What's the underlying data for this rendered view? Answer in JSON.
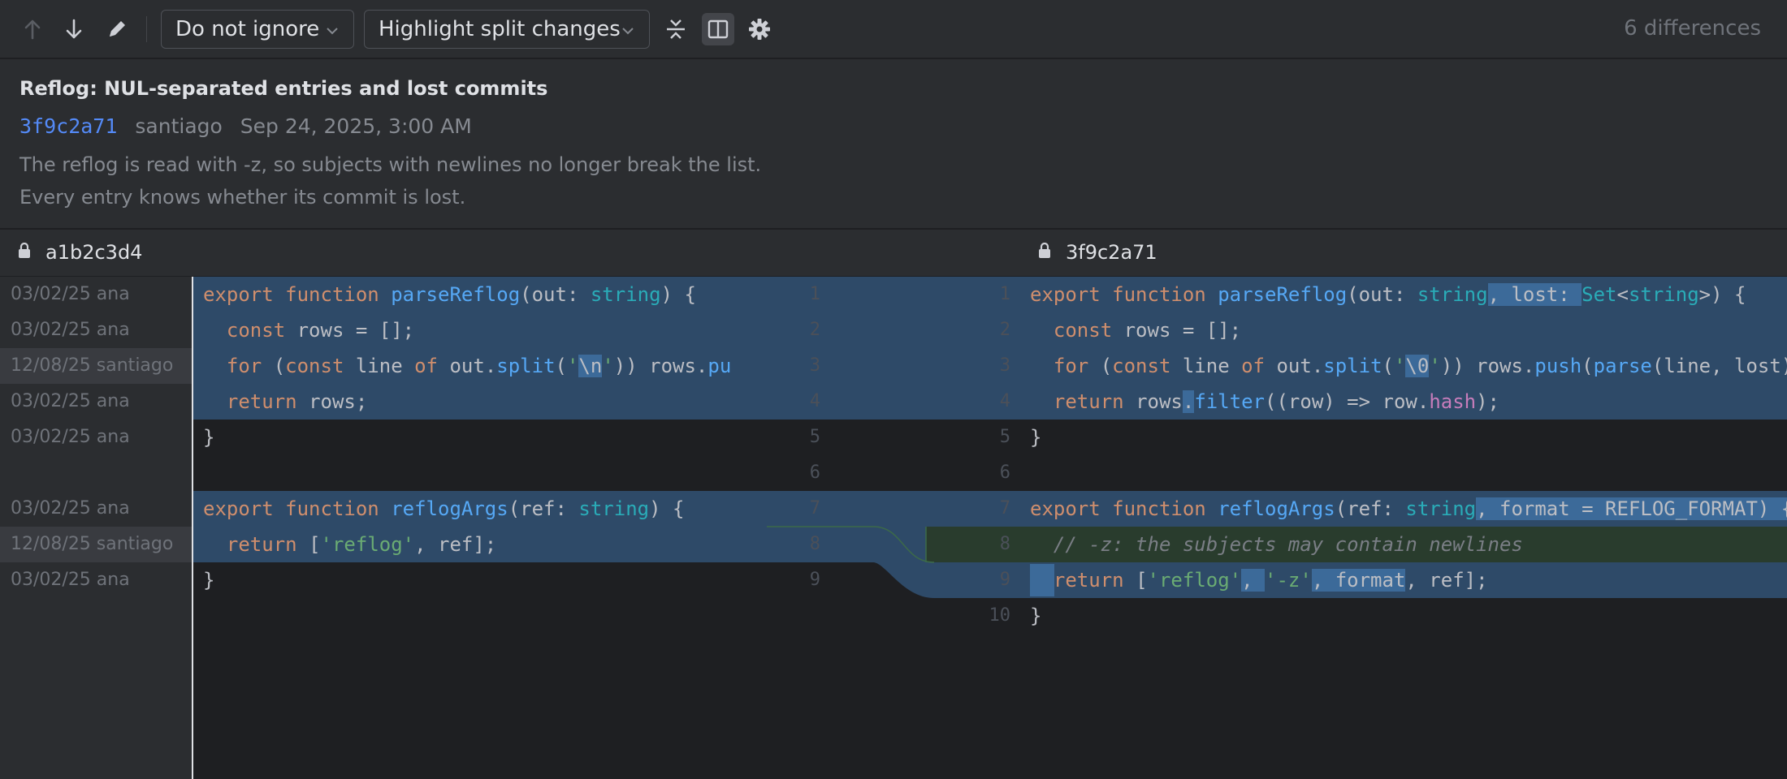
{
  "toolbar": {
    "prev_icon": "arrow-up-icon",
    "next_icon": "arrow-down-icon",
    "edit_icon": "pencil-icon",
    "ignore_dropdown": "Do not ignore",
    "highlight_dropdown": "Highlight split changes",
    "collapse_icon": "collapse-unchanged-icon",
    "side_by_side_icon": "side-by-side-icon",
    "settings_icon": "gear-icon",
    "differences": "6 differences"
  },
  "commit": {
    "title": "Reflog: NUL-separated entries and lost commits",
    "hash": "3f9c2a71",
    "author": "santiago",
    "date": "Sep 24, 2025, 3:00 AM",
    "description": [
      "The reflog is read with -z, so subjects with newlines no longer break the list.",
      "Every entry knows whether its commit is lost."
    ]
  },
  "files": {
    "left": "a1b2c3d4",
    "right": "3f9c2a71",
    "lock_icon": "lock-icon"
  },
  "blame": [
    "03/02/25 ana",
    "03/02/25 ana",
    "12/08/25 santiago",
    "03/02/25 ana",
    "03/02/25 ana",
    "",
    "03/02/25 ana",
    "12/08/25 santiago",
    "03/02/25 ana"
  ],
  "left_line_numbers": [
    "1",
    "2",
    "3",
    "4",
    "5",
    "6",
    "7",
    "8",
    "9"
  ],
  "right_line_numbers": [
    "1",
    "2",
    "3",
    "4",
    "5",
    "6",
    "7",
    "8",
    "9",
    "10"
  ],
  "left_code": [
    [
      [
        "kw",
        "export "
      ],
      [
        "kw",
        "function "
      ],
      [
        "fn",
        "parseReflog"
      ],
      [
        "pl",
        "(out: "
      ],
      [
        "ty",
        "string"
      ],
      [
        "pl",
        ") {"
      ]
    ],
    [
      [
        "pl",
        "  "
      ],
      [
        "kw",
        "const "
      ],
      [
        "pl",
        "rows = [];"
      ]
    ],
    [
      [
        "pl",
        "  "
      ],
      [
        "kw",
        "for "
      ],
      [
        "pl",
        "("
      ],
      [
        "kw",
        "const "
      ],
      [
        "pl",
        "line "
      ],
      [
        "kw",
        "of "
      ],
      [
        "pl",
        "out."
      ],
      [
        "fn",
        "split"
      ],
      [
        "pl",
        "("
      ],
      [
        "str",
        "'"
      ],
      [
        "wh",
        "\\n"
      ],
      [
        "str",
        "'"
      ],
      [
        "pl",
        ")) rows."
      ],
      [
        "fn",
        "pu"
      ]
    ],
    [
      [
        "pl",
        "  "
      ],
      [
        "kw",
        "return "
      ],
      [
        "pl",
        "rows;"
      ]
    ],
    [
      [
        "pl",
        "}"
      ]
    ],
    [],
    [
      [
        "kw",
        "export "
      ],
      [
        "kw",
        "function "
      ],
      [
        "fn",
        "reflogArgs"
      ],
      [
        "pl",
        "(ref: "
      ],
      [
        "ty",
        "string"
      ],
      [
        "pl",
        ") {"
      ]
    ],
    [
      [
        "pl",
        "  "
      ],
      [
        "kw",
        "return "
      ],
      [
        "pl",
        "["
      ],
      [
        "str",
        "'reflog'"
      ],
      [
        "pl",
        ", ref];"
      ]
    ],
    [
      [
        "pl",
        "}"
      ]
    ]
  ],
  "right_code": [
    [
      [
        "kw",
        "export "
      ],
      [
        "kw",
        "function "
      ],
      [
        "fn",
        "parseReflog"
      ],
      [
        "pl",
        "(out: "
      ],
      [
        "ty",
        "string"
      ],
      [
        "wh",
        ", lost: "
      ],
      [
        "ty",
        "Set"
      ],
      [
        "pl",
        "<"
      ],
      [
        "ty",
        "string"
      ],
      [
        "pl",
        ">) {"
      ]
    ],
    [
      [
        "pl",
        "  "
      ],
      [
        "kw",
        "const "
      ],
      [
        "pl",
        "rows = [];"
      ]
    ],
    [
      [
        "pl",
        "  "
      ],
      [
        "kw",
        "for "
      ],
      [
        "pl",
        "("
      ],
      [
        "kw",
        "const "
      ],
      [
        "pl",
        "line "
      ],
      [
        "kw",
        "of "
      ],
      [
        "pl",
        "out."
      ],
      [
        "fn",
        "split"
      ],
      [
        "pl",
        "("
      ],
      [
        "str",
        "'"
      ],
      [
        "wh",
        "\\0"
      ],
      [
        "str",
        "'"
      ],
      [
        "pl",
        ")) rows."
      ],
      [
        "fn",
        "push"
      ],
      [
        "pl",
        "("
      ],
      [
        "fn",
        "parse"
      ],
      [
        "pl",
        "(line, lost)));"
      ]
    ],
    [
      [
        "pl",
        "  "
      ],
      [
        "kw",
        "return "
      ],
      [
        "pl",
        "rows"
      ],
      [
        "wh",
        "."
      ],
      [
        "fn",
        "filter"
      ],
      [
        "pl",
        "((row) => row."
      ],
      [
        "mb",
        "hash"
      ],
      [
        "pl",
        ");"
      ]
    ],
    [
      [
        "pl",
        "}"
      ]
    ],
    [],
    [
      [
        "kw",
        "export "
      ],
      [
        "kw",
        "function "
      ],
      [
        "fn",
        "reflogArgs"
      ],
      [
        "pl",
        "(ref: "
      ],
      [
        "ty",
        "string"
      ],
      [
        "wh",
        ", format = REFLOG_FORMAT) {"
      ]
    ],
    [
      [
        "cm",
        "  // -z: the subjects may contain newlines"
      ]
    ],
    [
      [
        "wh",
        "  "
      ],
      [
        "kw",
        "return "
      ],
      [
        "pl",
        "["
      ],
      [
        "str",
        "'reflog'"
      ],
      [
        "wh",
        ", "
      ],
      [
        "str",
        "'-z'"
      ],
      [
        "wh",
        ", format"
      ],
      [
        "pl",
        ", ref];"
      ]
    ],
    [
      [
        "pl",
        "}"
      ]
    ]
  ],
  "colors": {
    "modified": "#2e4a68",
    "inserted": "#293c2d",
    "accent": "#548af7"
  }
}
